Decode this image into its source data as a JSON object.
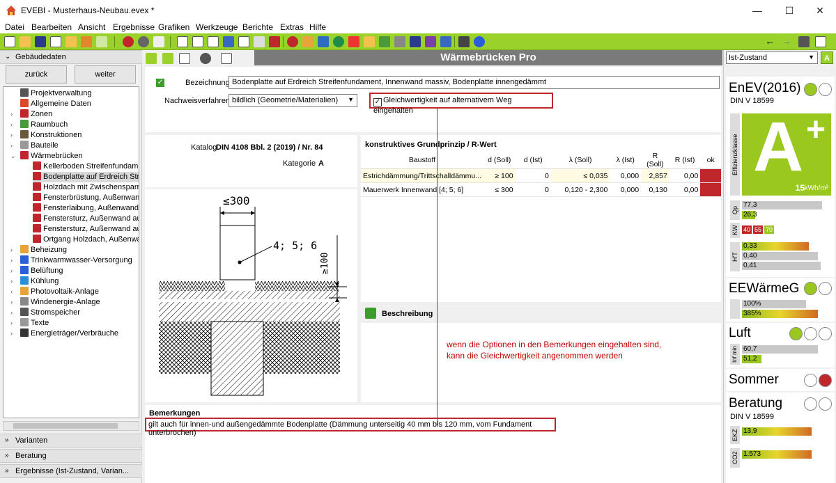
{
  "window": {
    "title": "EVEBI - Musterhaus-Neubau.evex *",
    "minimize": "—",
    "maximize": "☐",
    "close": "✕"
  },
  "menu": [
    "Datei",
    "Bearbeiten",
    "Ansicht",
    "Ergebnisse",
    "Grafiken",
    "Werkzeuge",
    "Berichte",
    "Extras",
    "Hilfe"
  ],
  "colors": {
    "toolbar": "#9bd12b",
    "accent_green": "#3c9d2c",
    "highlight_red": "#c0272d",
    "annotation_red": "#c00000"
  },
  "left": {
    "section_title": "Gebäudedaten",
    "back_label": "zurück",
    "next_label": "weiter",
    "tree": [
      {
        "label": "Projektverwaltung",
        "level": 1,
        "icon": "clock-icon"
      },
      {
        "label": "Allgemeine Daten",
        "level": 1,
        "icon": "house-icon"
      },
      {
        "label": "Zonen",
        "level": 1,
        "icon": "zones-icon",
        "expandable": true
      },
      {
        "label": "Raumbuch",
        "level": 1,
        "icon": "roombook-icon",
        "expandable": true
      },
      {
        "label": "Konstruktionen",
        "level": 1,
        "icon": "construction-icon",
        "expandable": true
      },
      {
        "label": "Bauteile",
        "level": 1,
        "icon": "component-icon",
        "expandable": true
      },
      {
        "label": "Wärmebrücken",
        "level": 1,
        "icon": "thermal-bridge-icon",
        "expanded": true
      },
      {
        "label": "Kellerboden Streifenfundamen",
        "level": 2,
        "icon": "bridge-item-icon"
      },
      {
        "label": "Bodenplatte auf Erdreich Streif",
        "level": 2,
        "icon": "bridge-item-icon",
        "selected": true
      },
      {
        "label": "Holzdach mit Zwischensparrenc",
        "level": 2,
        "icon": "bridge-item-icon"
      },
      {
        "label": "Fensterbrüstung, Außenwand",
        "level": 2,
        "icon": "bridge-item-icon"
      },
      {
        "label": "Fensterlaibung, Außenwand, a",
        "level": 2,
        "icon": "bridge-item-icon"
      },
      {
        "label": "Fenstersturz, Außenwand auß",
        "level": 2,
        "icon": "bridge-item-icon"
      },
      {
        "label": "Fenstersturz, Außenwand auß",
        "level": 2,
        "icon": "bridge-item-icon"
      },
      {
        "label": "Ortgang Holzdach, Außenwan",
        "level": 2,
        "icon": "bridge-item-icon"
      },
      {
        "label": "Beheizung",
        "level": 1,
        "icon": "heating-icon",
        "expandable": true
      },
      {
        "label": "Trinkwarmwasser-Versorgung",
        "level": 1,
        "icon": "water-drop-icon",
        "expandable": true
      },
      {
        "label": "Belüftung",
        "level": 1,
        "icon": "fan-icon",
        "expandable": true
      },
      {
        "label": "Kühlung",
        "level": 1,
        "icon": "snowflake-icon",
        "expandable": true
      },
      {
        "label": "Photovoltaik-Anlage",
        "level": 1,
        "icon": "solar-icon",
        "expandable": true
      },
      {
        "label": "Windenergie-Anlage",
        "level": 1,
        "icon": "wind-icon",
        "expandable": true
      },
      {
        "label": "Stromspeicher",
        "level": 1,
        "icon": "battery-icon",
        "expandable": true
      },
      {
        "label": "Texte",
        "level": 1,
        "icon": "text-icon",
        "expandable": true
      },
      {
        "label": "Energieträger/Verbräuche",
        "level": 1,
        "icon": "energy-icon",
        "expandable": true
      }
    ],
    "bottom_sections": [
      "Varianten",
      "Beratung",
      "Ergebnisse (Ist-Zustand, Varian..."
    ]
  },
  "main": {
    "header": "Wärmebrücken Pro",
    "bezeichnung_label": "Bezeichnung",
    "bezeichnung_value": "Bodenplatte auf Erdreich Streifenfundament, Innenwand massiv, Bodenplatte innengedämmt",
    "nachweis_label": "Nachweisverfahren",
    "nachweis_value": "bildlich (Geometrie/Materialien)",
    "alt_label": "Gleichwertigkeit auf alternativem Weg eingehalten",
    "katalog_label": "Katalog",
    "katalog_value": "DIN 4108 Bbl. 2 (2019) / Nr. 84",
    "kategorie_label": "Kategorie",
    "kategorie_value": "A",
    "drawing": {
      "dim_width": "≤300",
      "layers": "4; 5; 6",
      "dim_height": "≥100"
    },
    "table": {
      "title": "konstruktives Grundprinzip / R-Wert",
      "columns": [
        "Baustoff",
        "d (Soll)",
        "d (Ist)",
        "λ (Soll)",
        "λ (Ist)",
        "R (Soll)",
        "R (Ist)",
        "ok"
      ],
      "rows": [
        {
          "baustoff": "Estrichdämmung/Trittschalldämmu...",
          "d_soll": "≥ 100",
          "d_ist": "0",
          "l_soll": "≤ 0,035",
          "l_ist": "0,000",
          "r_soll": "2,857",
          "r_ist": "0,00"
        },
        {
          "baustoff": "Mauerwerk Innenwand [4; 5; 6]",
          "d_soll": "≤ 300",
          "d_ist": "0",
          "l_soll": "0,120 - 2,300",
          "l_ist": "0,000",
          "r_soll": "0,130",
          "r_ist": "0,00"
        }
      ]
    },
    "beschreibung_title": "Beschreibung",
    "annotation_line1": "wenn die Optionen in den Bemerkungen eingehalten sind,",
    "annotation_line2": "kann die Gleichwertigkeit angenommen werden",
    "bemerkungen_title": "Bemerkungen",
    "bemerkungen_text": "gilt auch für innen-und außengedämmte Bodenplatte (Dämmung unterseitig 40 mm bis 120 mm, vom Fundament unterbrochen)"
  },
  "right": {
    "dropdown": "Ist-Zustand",
    "a_button": "A",
    "enev": {
      "title": "EnEV(2016)",
      "norm": "DIN V 18599",
      "effizienz_label": "Effizienzklasse",
      "class_letter": "A",
      "class_plus": "+",
      "value": "15",
      "unit": "kWh/m²",
      "qp_label": "Qp",
      "qp_values": [
        "77,3",
        "26,3"
      ],
      "qp_fraction": [
        0.9,
        0.15
      ],
      "kw_label": "KW",
      "kw_values": [
        "40",
        "55",
        "70"
      ],
      "ht_label": "H'T",
      "ht_values": [
        "0,33",
        "0,40",
        "0,41"
      ],
      "ht_fraction": [
        0.75,
        0.85,
        0.88
      ]
    },
    "eew": {
      "title": "EEWärmeG",
      "values": [
        "100%",
        "385%"
      ],
      "fraction": [
        0.72,
        0.85
      ]
    },
    "luft": {
      "title": "Luft",
      "label": "Inf min",
      "values": [
        "60,7",
        "51,2"
      ],
      "fraction": [
        0.85,
        0.22
      ]
    },
    "sommer": {
      "title": "Sommer"
    },
    "beratung": {
      "title": "Beratung",
      "norm": "DIN V 18599",
      "ekz_label": "EKZ",
      "ekz_value": "13,9",
      "co2_label": "CO2",
      "co2_value": "1.573"
    }
  }
}
